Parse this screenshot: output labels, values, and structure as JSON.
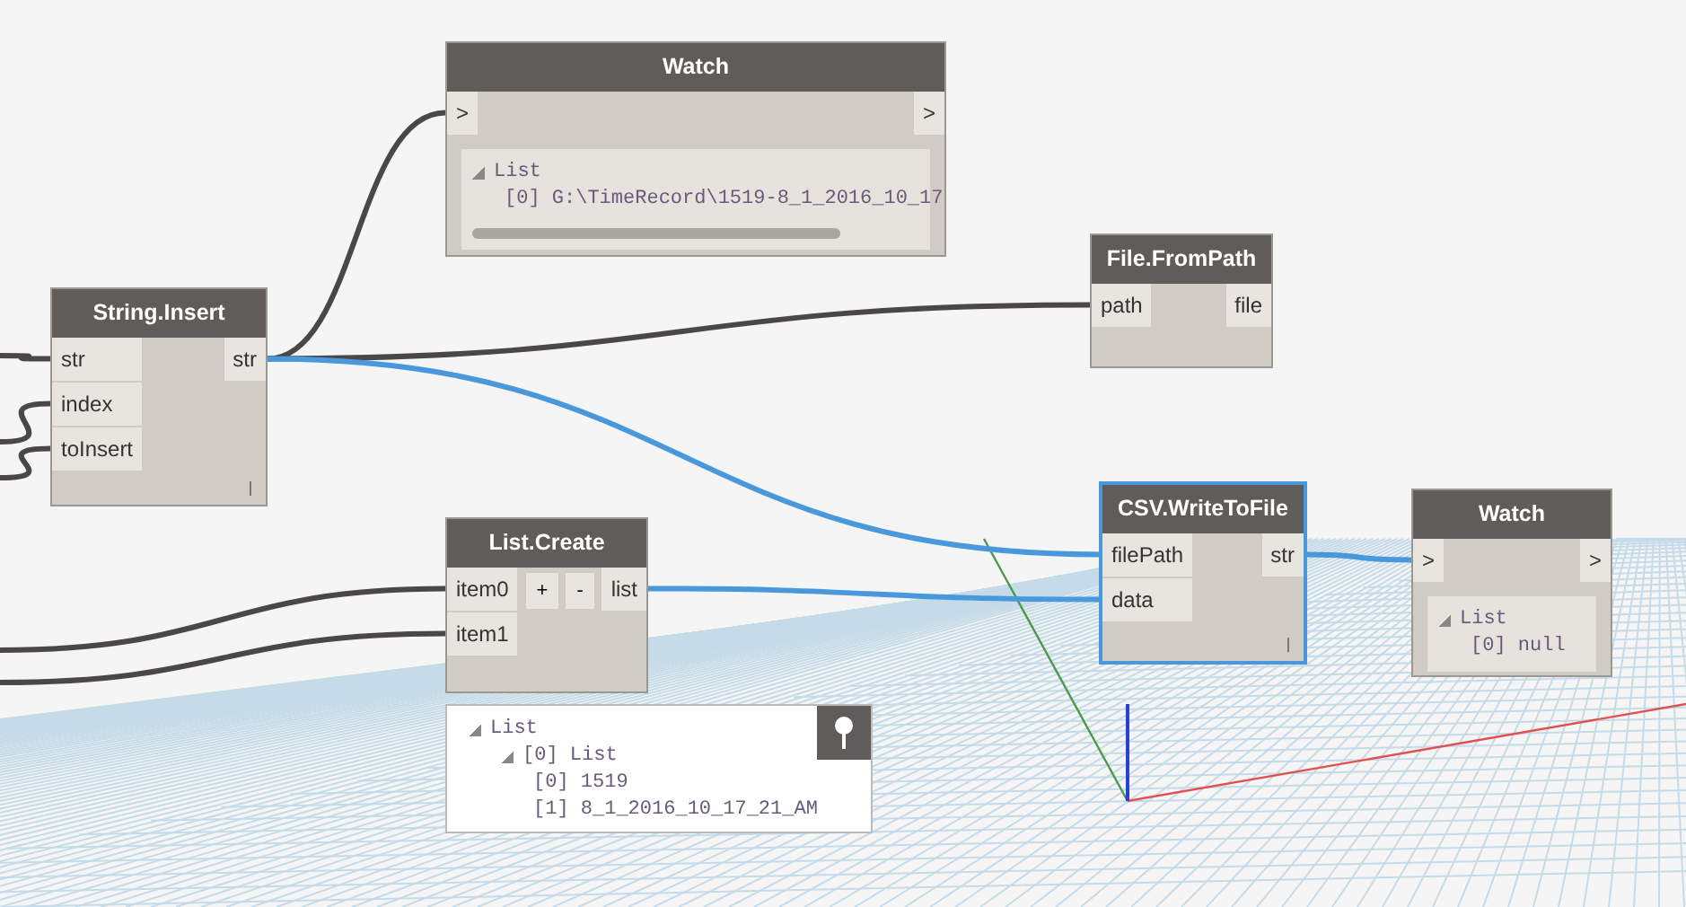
{
  "nodes": [
    {
      "title": "Watch",
      "kind": "watch",
      "selected": false,
      "inputs": [
        ">"
      ],
      "outputs": [
        ">"
      ],
      "horizontal_scroll": true,
      "preview": [
        {
          "label": "List",
          "expanded": true,
          "children": [
            {
              "label": "[0] G:\\TimeRecord\\1519-8_1_2016_10_17"
            }
          ]
        }
      ]
    },
    {
      "title": "String.Insert",
      "kind": "function",
      "selected": false,
      "inputs": [
        "str",
        "index",
        "toInsert"
      ],
      "outputs": [
        "str"
      ],
      "lacing": true
    },
    {
      "title": "File.FromPath",
      "kind": "function",
      "selected": false,
      "inputs": [
        "path"
      ],
      "outputs": [
        "file"
      ],
      "lacing": false
    },
    {
      "title": "List.Create",
      "kind": "variadic",
      "selected": false,
      "inputs": [
        "item0",
        "item1"
      ],
      "outputs": [
        "list"
      ],
      "buttons": [
        "+",
        "-"
      ],
      "lacing": false,
      "preview_bubble": [
        {
          "label": "List",
          "expanded": true,
          "children": [
            {
              "label": "[0] List",
              "expanded": true,
              "children": [
                {
                  "label": "[0] 1519"
                },
                {
                  "label": "[1] 8_1_2016_10_17_21_AM"
                }
              ]
            }
          ]
        }
      ]
    },
    {
      "title": "CSV.WriteToFile",
      "kind": "function",
      "selected": true,
      "inputs": [
        "filePath",
        "data"
      ],
      "outputs": [
        "str"
      ],
      "lacing": true
    },
    {
      "title": "Watch",
      "kind": "watch",
      "selected": false,
      "inputs": [
        ">"
      ],
      "outputs": [
        ">"
      ],
      "horizontal_scroll": false,
      "preview": [
        {
          "label": "List",
          "expanded": true,
          "children": [
            {
              "label": "[0] null"
            }
          ]
        }
      ]
    }
  ],
  "edges": [
    {
      "highlighted": false
    },
    {
      "highlighted": false
    },
    {
      "highlighted": false
    },
    {
      "highlighted": false
    },
    {
      "highlighted": false
    },
    {
      "highlighted": false
    },
    {
      "highlighted": false
    },
    {
      "highlighted": true
    },
    {
      "highlighted": true
    },
    {
      "highlighted": true
    }
  ]
}
